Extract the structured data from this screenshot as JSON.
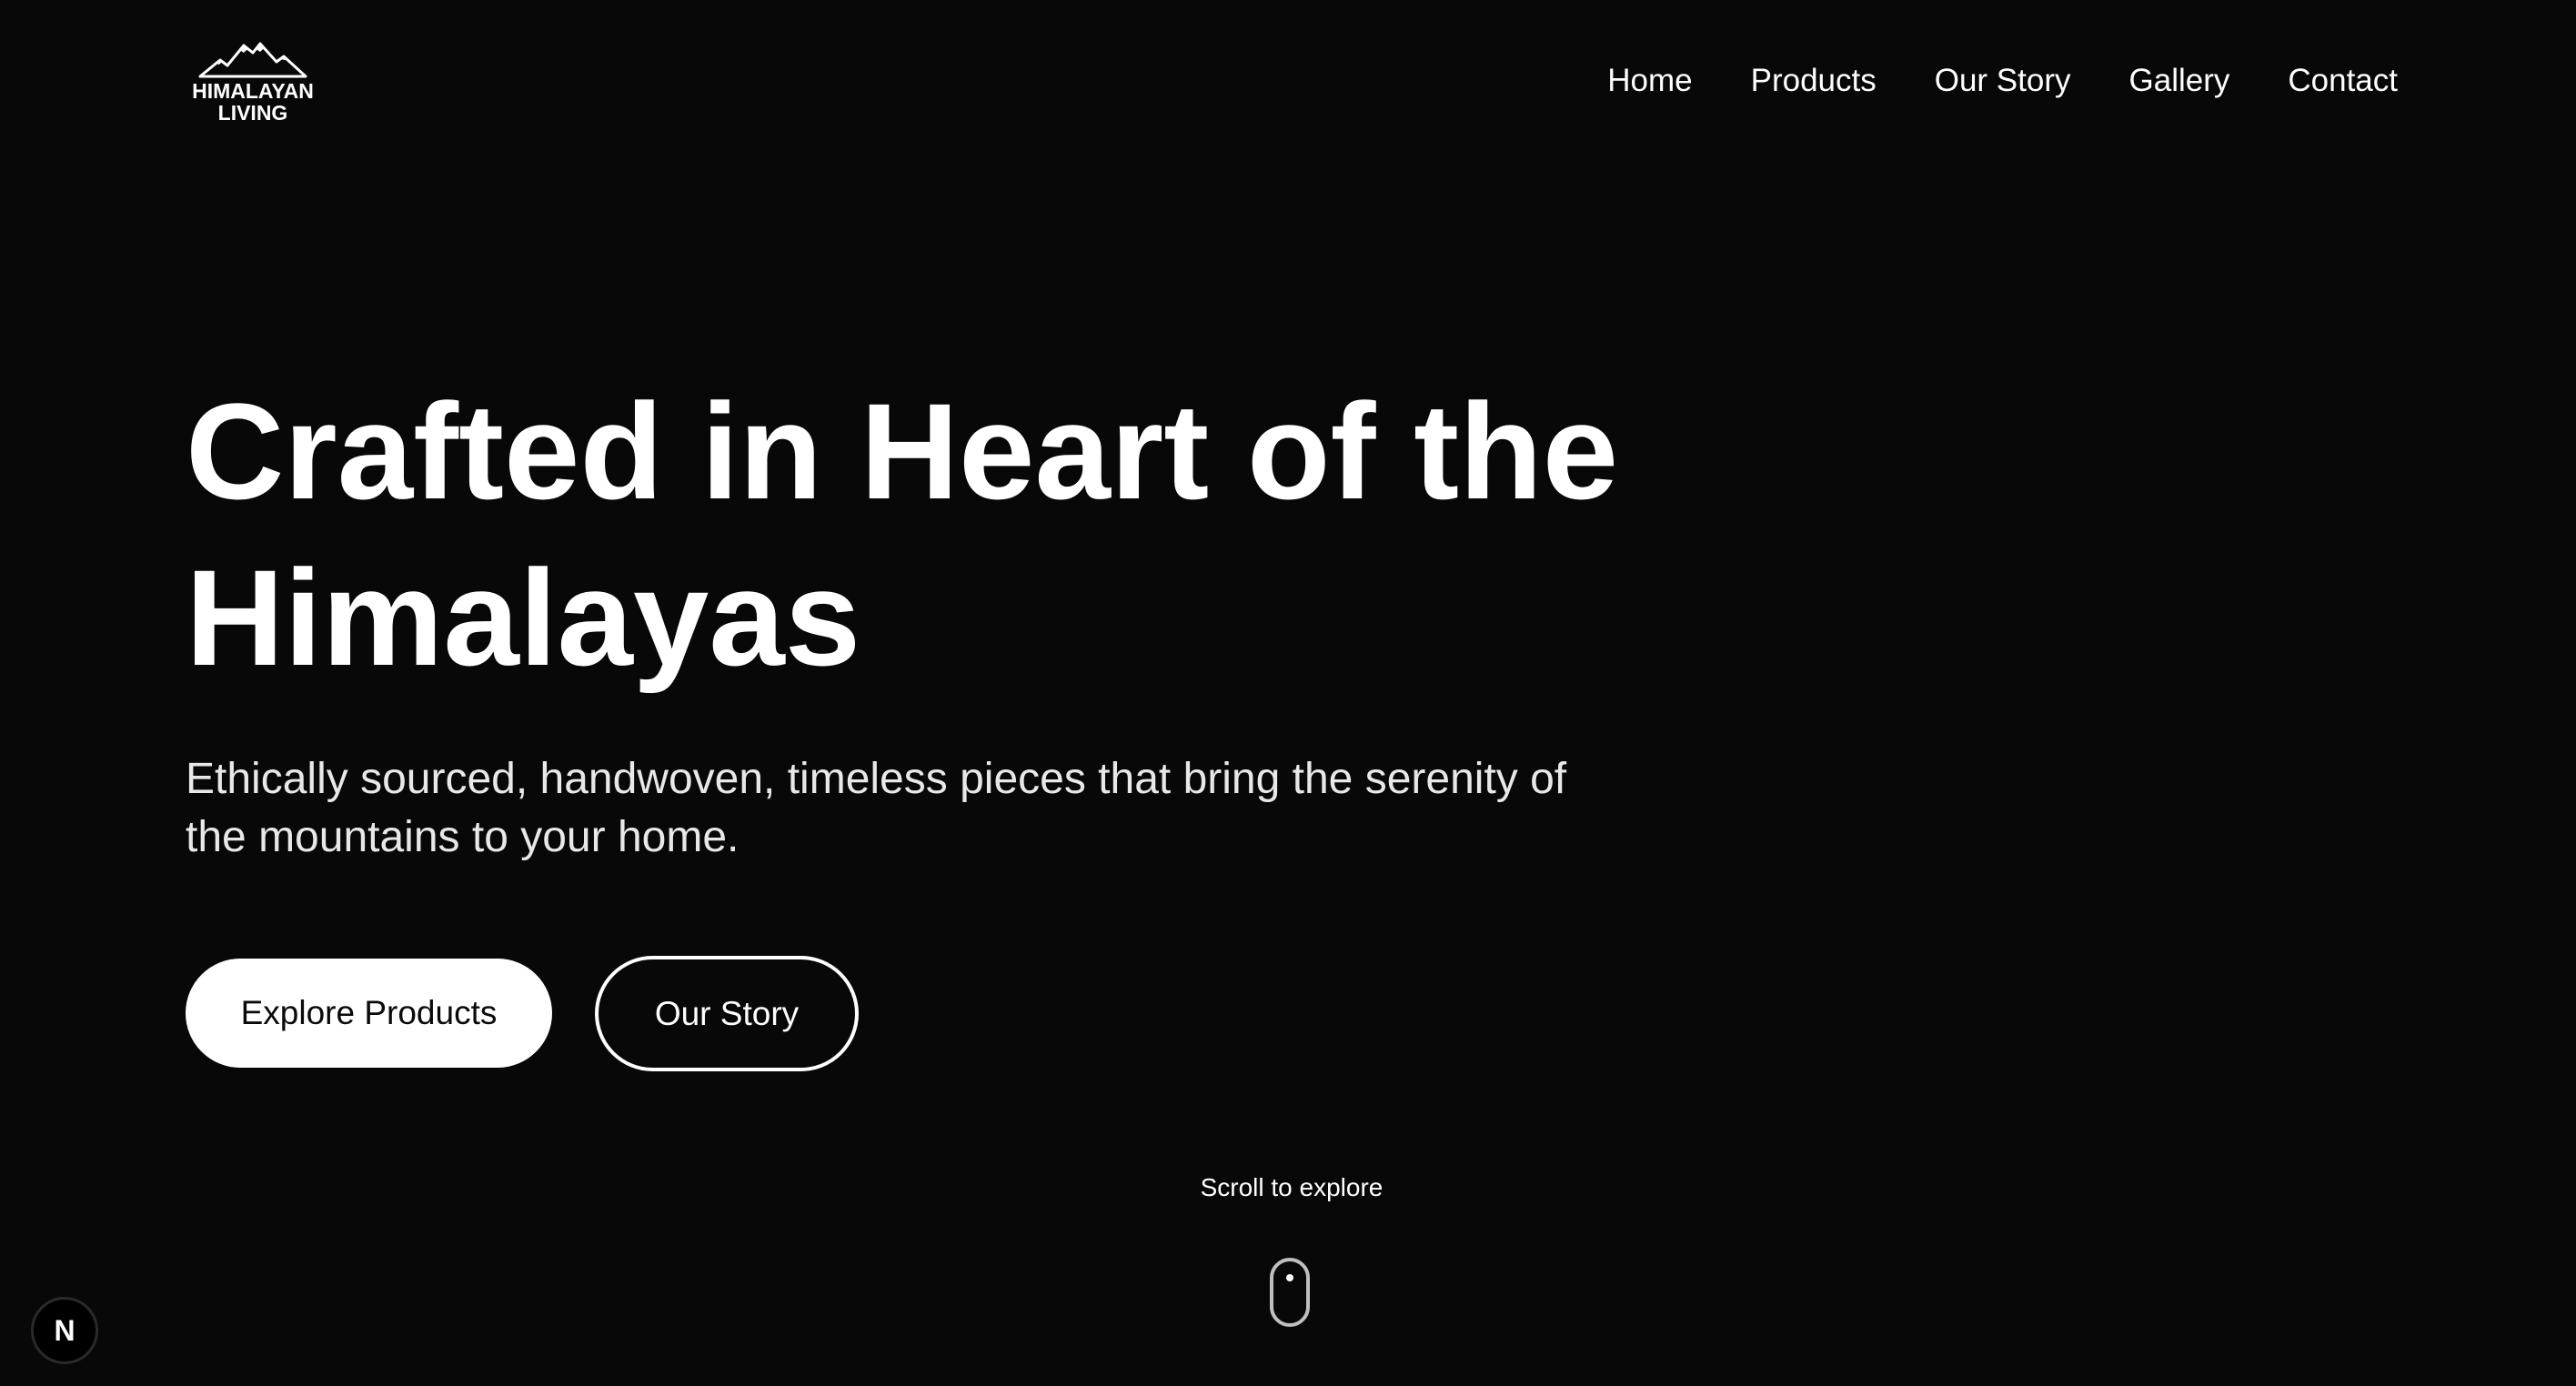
{
  "brand": {
    "logo_text": "HIMALAYAN LIVING",
    "logo_line1": "HIMALAYAN",
    "logo_line2": "LIVING",
    "logo_icon": "mountain-peaks-icon"
  },
  "nav": {
    "items": [
      {
        "label": "Home"
      },
      {
        "label": "Products"
      },
      {
        "label": "Our Story"
      },
      {
        "label": "Gallery"
      },
      {
        "label": "Contact"
      }
    ]
  },
  "hero": {
    "title_line1": "Crafted in Heart of the",
    "title_line2": "Himalayas",
    "subtitle": "Ethically sourced, handwoven, timeless pieces that bring the serenity of the mountains to your home.",
    "primary_button": "Explore Products",
    "secondary_button": "Our Story"
  },
  "scroll": {
    "label": "Scroll to explore",
    "icon": "mouse-scroll-icon"
  },
  "dev_badge": {
    "label": "N",
    "icon": "nextjs-logo-icon"
  },
  "colors": {
    "background": "#080808",
    "text": "#ffffff",
    "button_primary_bg": "#ffffff",
    "button_primary_text": "#0a0a0a"
  }
}
